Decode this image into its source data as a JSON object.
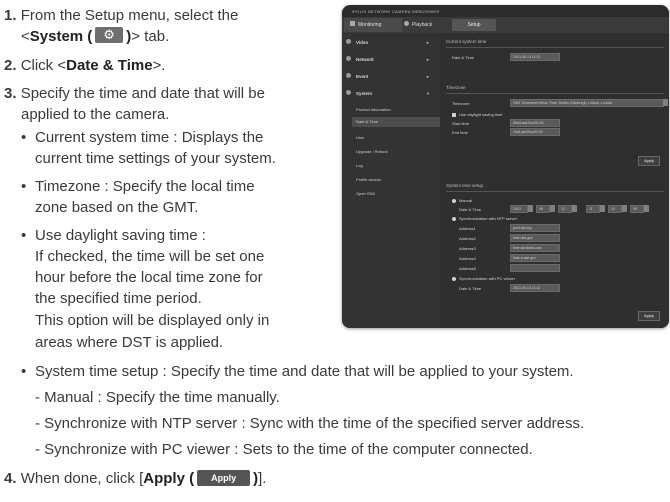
{
  "instructions": {
    "step1": {
      "num": "1.",
      "text_a": "From the Setup menu, select the",
      "text_b_pre": "<",
      "text_b_bold": "System (",
      "text_b_bold2": ")",
      "text_b_post": "> tab."
    },
    "step2": {
      "num": "2.",
      "pre": "Click <",
      "bold": "Date & Time",
      "post": ">."
    },
    "step3": {
      "num": "3.",
      "line1": "Specify the time and date that will be",
      "line2": "applied to the camera."
    },
    "bullets": [
      {
        "line1": "Current system time : Displays the",
        "line2": "current time settings of your system."
      },
      {
        "line1": "Timezone : Specify the local time",
        "line2": "zone based on the GMT."
      },
      {
        "line1": "Use daylight saving time :",
        "line2": "If checked, the time will be set one",
        "line3": "hour before the local time zone for",
        "line4": "the specified time period.",
        "line5": "This option will be displayed only in",
        "line6": "areas where DST is applied."
      },
      {
        "line1": "System time setup : Specify the time and date that will be applied to your system."
      }
    ],
    "subitems": [
      "- Manual : Specify the time manually.",
      "- Synchronize with NTP server : Sync with the time of the specified server address.",
      "- Synchronize with PC viewer : Sets to the time of the computer connected."
    ],
    "step4": {
      "num": "4.",
      "pre": "When done, click [",
      "bold": "Apply (",
      "bold2": ")",
      "post": "].",
      "apply_icon": "Apply"
    }
  },
  "screenshot": {
    "title": "iPOLIS NETWORK CAMERA WEBVIEWER",
    "top_buttons": {
      "monitoring": "Monitoring",
      "playback": "Playback",
      "setup": "Setup"
    },
    "sidebar": {
      "video": "Video",
      "network": "Network",
      "event": "Event",
      "system": "System",
      "sub": [
        "Product information",
        "Date & Time",
        "User",
        "Upgrade / Reboot",
        "Log",
        "Profile access",
        "Open SDK"
      ]
    },
    "current_time": {
      "header": "Current system time",
      "label": "Date & Time",
      "value": "2013-05-13 11:12"
    },
    "timezone": {
      "header": "Timezone",
      "label": "Timezone",
      "value": "GMT Greenwich Mean Time: Dublin, Edinburgh, Lisbon, London",
      "dst": "Use daylight saving time",
      "start_label": "Start time",
      "start_value": "Mar/Last/Sun/01:00",
      "end_label": "End time",
      "end_value": "Oct/Last/Sun/02:00",
      "apply": "Apply"
    },
    "system_time": {
      "header": "System time setup",
      "manual": "Manual",
      "date_time": "Date & Time",
      "manual_fields": [
        "2013",
        "05",
        "13",
        "11",
        "12",
        "09"
      ],
      "ntp": "Synchronization with NTP server",
      "address_labels": [
        "Address1",
        "Address2",
        "Address3",
        "Address4",
        "Address5"
      ],
      "address_values": [
        "pool.ntp.org",
        "time.nist.gov",
        "time.windows.com",
        "time-a.nist.gov",
        ""
      ],
      "pc": "Synchronization with PC viewer",
      "pc_label": "Date & Time",
      "pc_value": "2013-05-13 11:12",
      "apply": "Apply"
    }
  }
}
